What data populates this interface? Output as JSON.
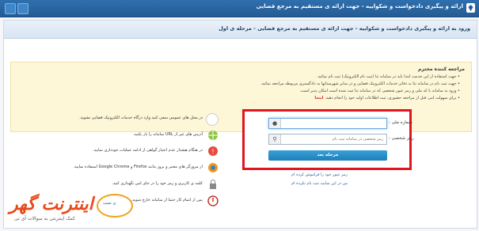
{
  "topbar": {
    "title": "ارائه و پیگیری دادخواست و شکواییه - جهت ارائه ی مستقیم به مرجع قضایی"
  },
  "header": {
    "text": "ورود به ارائه و پیگیری دادخواست و شکواییه - جهت ارائه ی مستقیم به مرجع قضایی - مرحله ی اول"
  },
  "notice": {
    "title": "مراجعه کننده محترم",
    "items": [
      "جهت استفاده از این خدمت ابتدا باید در سامانه ثنا (ثبت نام الکترونیک) ثبت نام نمائید.",
      "جهت ثبت نام در سامانه ثنا به دفاتر خدمات الکترونیک قضایی و در سایر شهرستانها به دادگستری مربوطه مراجعه نمائید.",
      "ورود به سامانه با کد ملی و رمز عبور شخصی که در سامانه ثنا ثبت شده است امکان پذیر است.",
      "برای سهولت امر، قبل از مراجعه حضوری، ثبت اطلاعات اولیه خود را انجام دهید."
    ],
    "highlight": "اینجا"
  },
  "features": [
    "در محل های عمومی سعی کنید وارد درگاه خدمات الکترونیک قضایی نشوید.",
    "آدرس های غیر از URL سامانه را باز نکنید.",
    "در هنگام هشدار عدم اعتبار گواهی از ادامه عملیات خودداری نمایید.",
    "از مرورگر های معتبر و بروز مانند Firefox و Google Chrome استفاده نمایید.",
    "کلمه ی کاربری و رمز خود را در جای امن نگهداری کنید.",
    "پس از اتمام کار حتما از سامانه خارج شوید."
  ],
  "form": {
    "username_label": "شماره ملی :",
    "username_value": "",
    "password_label": "رمز شخصی :",
    "password_placeholder": "رمز شخصی در سامانه ثبت نام",
    "submit_label": "مرحله بعد"
  },
  "links": {
    "forgot": "رمز عبور خود را فراموش کرده ام",
    "register": "من در این سایت ثبت نام نکرده ام"
  },
  "watermark": {
    "main": "اینترنت گهر",
    "sub": "کمک اینترنتی به سوالات آی تی",
    "badge": "ی تست"
  },
  "colors": {
    "accent": "#245c94",
    "alert": "#e0151f",
    "button": "#1d7fb9"
  }
}
